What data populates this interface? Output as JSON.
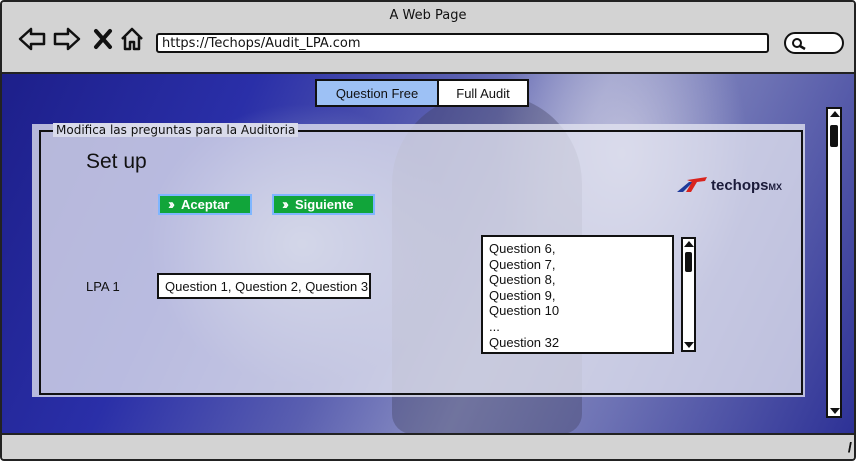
{
  "window": {
    "title": "A Web Page"
  },
  "browser": {
    "url": "https://Techops/Audit_LPA.com",
    "nav": [
      "back-arrow-icon",
      "forward-arrow-icon",
      "close-x-icon",
      "home-icon"
    ]
  },
  "tabs": [
    {
      "label": "Question Free",
      "active": true
    },
    {
      "label": "Full Audit",
      "active": false
    }
  ],
  "form": {
    "legend": "Modifica las preguntas para la Auditoria",
    "title": "Set up",
    "accept_label": "Aceptar",
    "next_label": "Siguiente",
    "logo_text": "techops",
    "logo_suffix": "MX",
    "lpa_label": "LPA 1",
    "lpa_value": "Question 1, Question 2, Question 3,",
    "question_list": [
      "Question 6,",
      "Question 7,",
      "Question 8,",
      "Question 9,",
      "Question 10",
      "...",
      "Question 32"
    ]
  },
  "colors": {
    "accent_green": "#11a53a",
    "tab_active": "#9dc1f5",
    "background_blue": "#2a2fa8"
  }
}
